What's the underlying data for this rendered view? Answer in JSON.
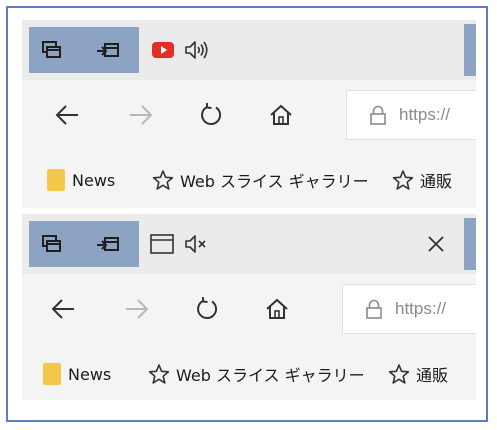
{
  "window_top": {
    "navbar": {
      "address_text": "https://"
    },
    "favorites": [
      {
        "label": "News"
      },
      {
        "label": "Web スライス ギャラリー"
      },
      {
        "label": "通販"
      }
    ]
  },
  "window_bottom": {
    "navbar": {
      "address_text": "https://"
    },
    "favorites": [
      {
        "label": "News"
      },
      {
        "label": "Web スライス ギャラリー"
      },
      {
        "label": "通販"
      }
    ]
  },
  "colors": {
    "frame_border": "#5b7fc1",
    "tab_buttons_bg": "#8da3c4",
    "youtube_red": "#e52d27",
    "folder_yellow": "#f4c84a"
  },
  "icons": {
    "tab_buttons": [
      "tabs-preview-icon",
      "set-tabs-aside-icon"
    ],
    "nav": [
      "back-arrow-icon",
      "forward-arrow-icon",
      "refresh-icon",
      "home-icon",
      "lock-icon"
    ],
    "tab_top": [
      "youtube-icon",
      "audio-playing-icon"
    ],
    "tab_bottom": [
      "blank-page-icon",
      "audio-muted-icon",
      "close-icon"
    ],
    "favorites": [
      "folder-icon",
      "star-icon",
      "star-icon"
    ]
  }
}
